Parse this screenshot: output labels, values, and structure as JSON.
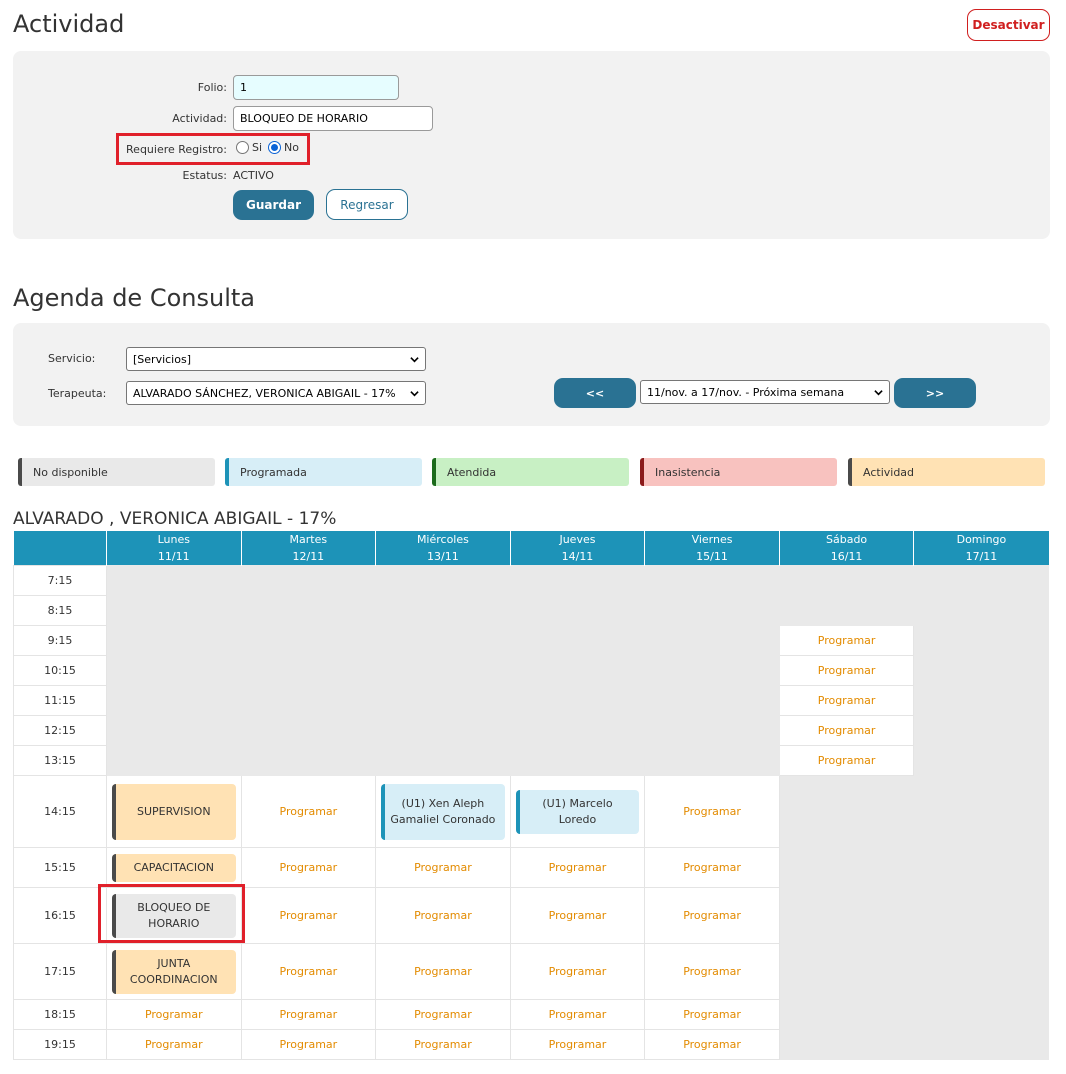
{
  "actividad": {
    "title": "Actividad",
    "deactivate_label": "Desactivar",
    "folio_label": "Folio:",
    "folio_value": "1",
    "actividad_label": "Actividad:",
    "actividad_value": "BLOQUEO DE HORARIO",
    "requiere_label": "Requiere Registro:",
    "si_label": "Si",
    "no_label": "No",
    "requiere_selected": "No",
    "estatus_label": "Estatus:",
    "estatus_value": "ACTIVO",
    "save_label": "Guardar",
    "back_label": "Regresar"
  },
  "agenda": {
    "title": "Agenda de Consulta",
    "servicio_label": "Servicio:",
    "servicio_value": "[Servicios]",
    "terapeuta_label": "Terapeuta:",
    "terapeuta_value": "ALVARADO SÁNCHEZ, VERONICA ABIGAIL - 17%",
    "prev_label": "<<",
    "week_value": "11/nov. a 17/nov. - Próxima semana",
    "next_label": ">>"
  },
  "legend": [
    {
      "label": "No disponible",
      "bg": "#e9e9e9",
      "bar": "#4a4a4a"
    },
    {
      "label": "Programada",
      "bg": "#d7eef7",
      "bar": "#1d93b8"
    },
    {
      "label": "Atendida",
      "bg": "#c8f0c4",
      "bar": "#1c6b1c"
    },
    {
      "label": "Inasistencia",
      "bg": "#f8c2bf",
      "bar": "#8b1a1a"
    },
    {
      "label": "Actividad",
      "bg": "#ffe2b4",
      "bar": "#4a4a4a"
    }
  ],
  "schedule": {
    "therapist": "ALVARADO , VERONICA ABIGAIL - 17%",
    "schedule_label": "Programar",
    "days": [
      {
        "name": "Lunes",
        "date": "11/11"
      },
      {
        "name": "Martes",
        "date": "12/11"
      },
      {
        "name": "Miércoles",
        "date": "13/11"
      },
      {
        "name": "Jueves",
        "date": "14/11"
      },
      {
        "name": "Viernes",
        "date": "15/11"
      },
      {
        "name": "Sábado",
        "date": "16/11"
      },
      {
        "name": "Domingo",
        "date": "17/11"
      }
    ],
    "rows": [
      {
        "time": "7:15",
        "cells": [
          "u",
          "u",
          "u",
          "u",
          "u",
          "u",
          "u"
        ]
      },
      {
        "time": "8:15",
        "cells": [
          "u",
          "u",
          "u",
          "u",
          "u",
          "u",
          "u"
        ]
      },
      {
        "time": "9:15",
        "cells": [
          "u",
          "u",
          "u",
          "u",
          "u",
          "p",
          "u"
        ]
      },
      {
        "time": "10:15",
        "cells": [
          "u",
          "u",
          "u",
          "u",
          "u",
          "p",
          "u"
        ]
      },
      {
        "time": "11:15",
        "cells": [
          "u",
          "u",
          "u",
          "u",
          "u",
          "p",
          "u"
        ]
      },
      {
        "time": "12:15",
        "cells": [
          "u",
          "u",
          "u",
          "u",
          "u",
          "p",
          "u"
        ]
      },
      {
        "time": "13:15",
        "cells": [
          "u",
          "u",
          "u",
          "u",
          "u",
          "p",
          "u"
        ]
      },
      {
        "time": "14:15",
        "cells": [
          {
            "type": "activity",
            "label": "SUPERVISION"
          },
          "p",
          {
            "type": "scheduled",
            "label": "(U1) Xen Aleph Gamaliel Coronado"
          },
          {
            "type": "scheduled",
            "label": "(U1) Marcelo Loredo"
          },
          "p",
          "u",
          "u"
        ]
      },
      {
        "time": "15:15",
        "cells": [
          {
            "type": "activity",
            "label": "CAPACITACION"
          },
          "p",
          "p",
          "p",
          "p",
          "u",
          "u"
        ]
      },
      {
        "time": "16:15",
        "cells": [
          {
            "type": "blocked",
            "label": "BLOQUEO DE HORARIO"
          },
          "p",
          "p",
          "p",
          "p",
          "u",
          "u"
        ]
      },
      {
        "time": "17:15",
        "cells": [
          {
            "type": "activity",
            "label": "JUNTA COORDINACION"
          },
          "p",
          "p",
          "p",
          "p",
          "u",
          "u"
        ]
      },
      {
        "time": "18:15",
        "cells": [
          "p",
          "p",
          "p",
          "p",
          "p",
          "u",
          "u"
        ]
      },
      {
        "time": "19:15",
        "cells": [
          "p",
          "p",
          "p",
          "p",
          "p",
          "u",
          "u"
        ]
      }
    ]
  }
}
